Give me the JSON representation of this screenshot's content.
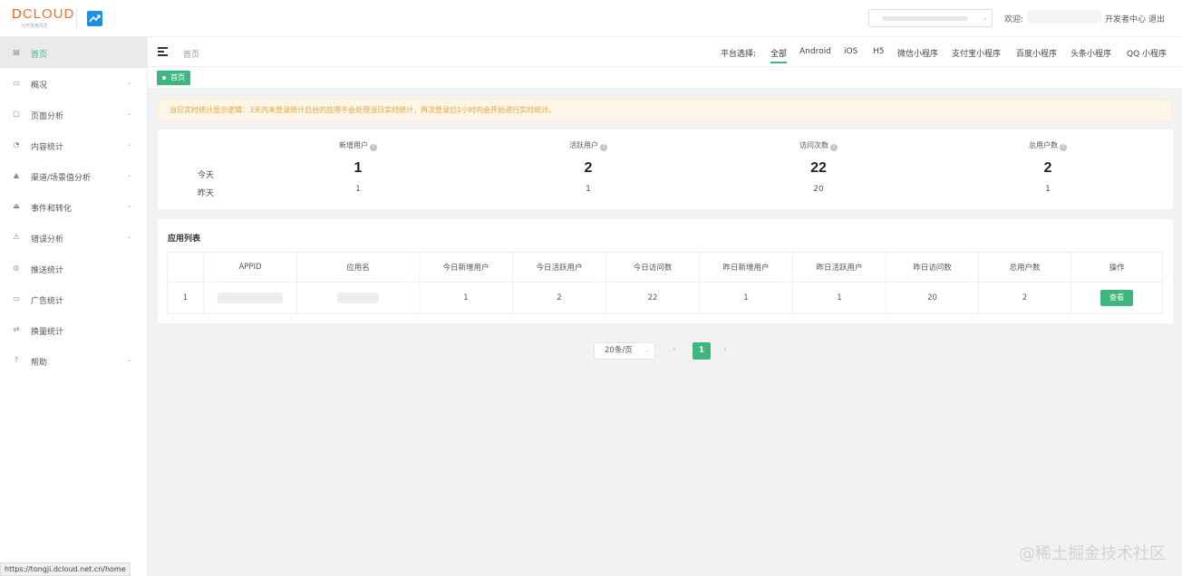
{
  "header": {
    "brand": "DCLOUD",
    "tagline": "为开发者而生",
    "welcome": "欢迎:",
    "dev_center": "开发者中心",
    "logout": "退出"
  },
  "sidebar": {
    "items": [
      {
        "label": "首页",
        "icon": "home-icon",
        "active": true,
        "chevron": ""
      },
      {
        "label": "概况",
        "icon": "overview-icon",
        "chevron": "⌄"
      },
      {
        "label": "页面分析",
        "icon": "page-icon",
        "chevron": "⌄"
      },
      {
        "label": "内容统计",
        "icon": "pie-icon",
        "chevron": "⌄"
      },
      {
        "label": "渠道/场景值分析",
        "icon": "channel-icon",
        "chevron": "⌄"
      },
      {
        "label": "事件和转化",
        "icon": "event-icon",
        "chevron": "⌄"
      },
      {
        "label": "错误分析",
        "icon": "warning-icon",
        "chevron": "⌄"
      },
      {
        "label": "推送统计",
        "icon": "push-icon",
        "chevron": ""
      },
      {
        "label": "广告统计",
        "icon": "ad-icon",
        "chevron": ""
      },
      {
        "label": "换量统计",
        "icon": "exchange-icon",
        "chevron": ""
      },
      {
        "label": "帮助",
        "icon": "help-icon",
        "chevron": "⌄"
      }
    ],
    "status_url": "https://tongji.dcloud.net.cn/home"
  },
  "topbar": {
    "breadcrumb": "首页",
    "platform_label": "平台选择:",
    "platforms": [
      "全部",
      "Android",
      "iOS",
      "H5",
      "微信小程序",
      "支付宝小程序",
      "百度小程序",
      "头条小程序",
      "QQ 小程序"
    ],
    "active_platform": "全部"
  },
  "tags": {
    "home": "首页"
  },
  "notice": "当日实时统计显示逻辑：3天内未登录统计后台的应用不会处理当日实时统计，再次登录后1小时内会开始进行实时统计。",
  "stats": {
    "today_label": "今天",
    "yesterday_label": "昨天",
    "columns": [
      {
        "title": "新增用户",
        "today": "1",
        "yesterday": "1"
      },
      {
        "title": "活跃用户",
        "today": "2",
        "yesterday": "1"
      },
      {
        "title": "访问次数",
        "today": "22",
        "yesterday": "20"
      },
      {
        "title": "总用户数",
        "today": "2",
        "yesterday": "1"
      }
    ]
  },
  "applist": {
    "title": "应用列表",
    "headers": [
      "",
      "APPID",
      "应用名",
      "今日新增用户",
      "今日活跃用户",
      "今日访问数",
      "昨日新增用户",
      "昨日活跃用户",
      "昨日访问数",
      "总用户数",
      "操作"
    ],
    "rows": [
      {
        "index": "1",
        "today_new": "1",
        "today_active": "2",
        "today_visits": "22",
        "yest_new": "1",
        "yest_active": "1",
        "yest_visits": "20",
        "total": "2",
        "action": "查看"
      }
    ]
  },
  "pagination": {
    "page_size": "20条/页",
    "prev": "‹",
    "current": "1",
    "next": "›"
  },
  "watermark": "@稀土掘金技术社区",
  "colors": {
    "accent": "#3eb77f",
    "notice_text": "#e6a23c",
    "brand": "#e85a1b"
  }
}
